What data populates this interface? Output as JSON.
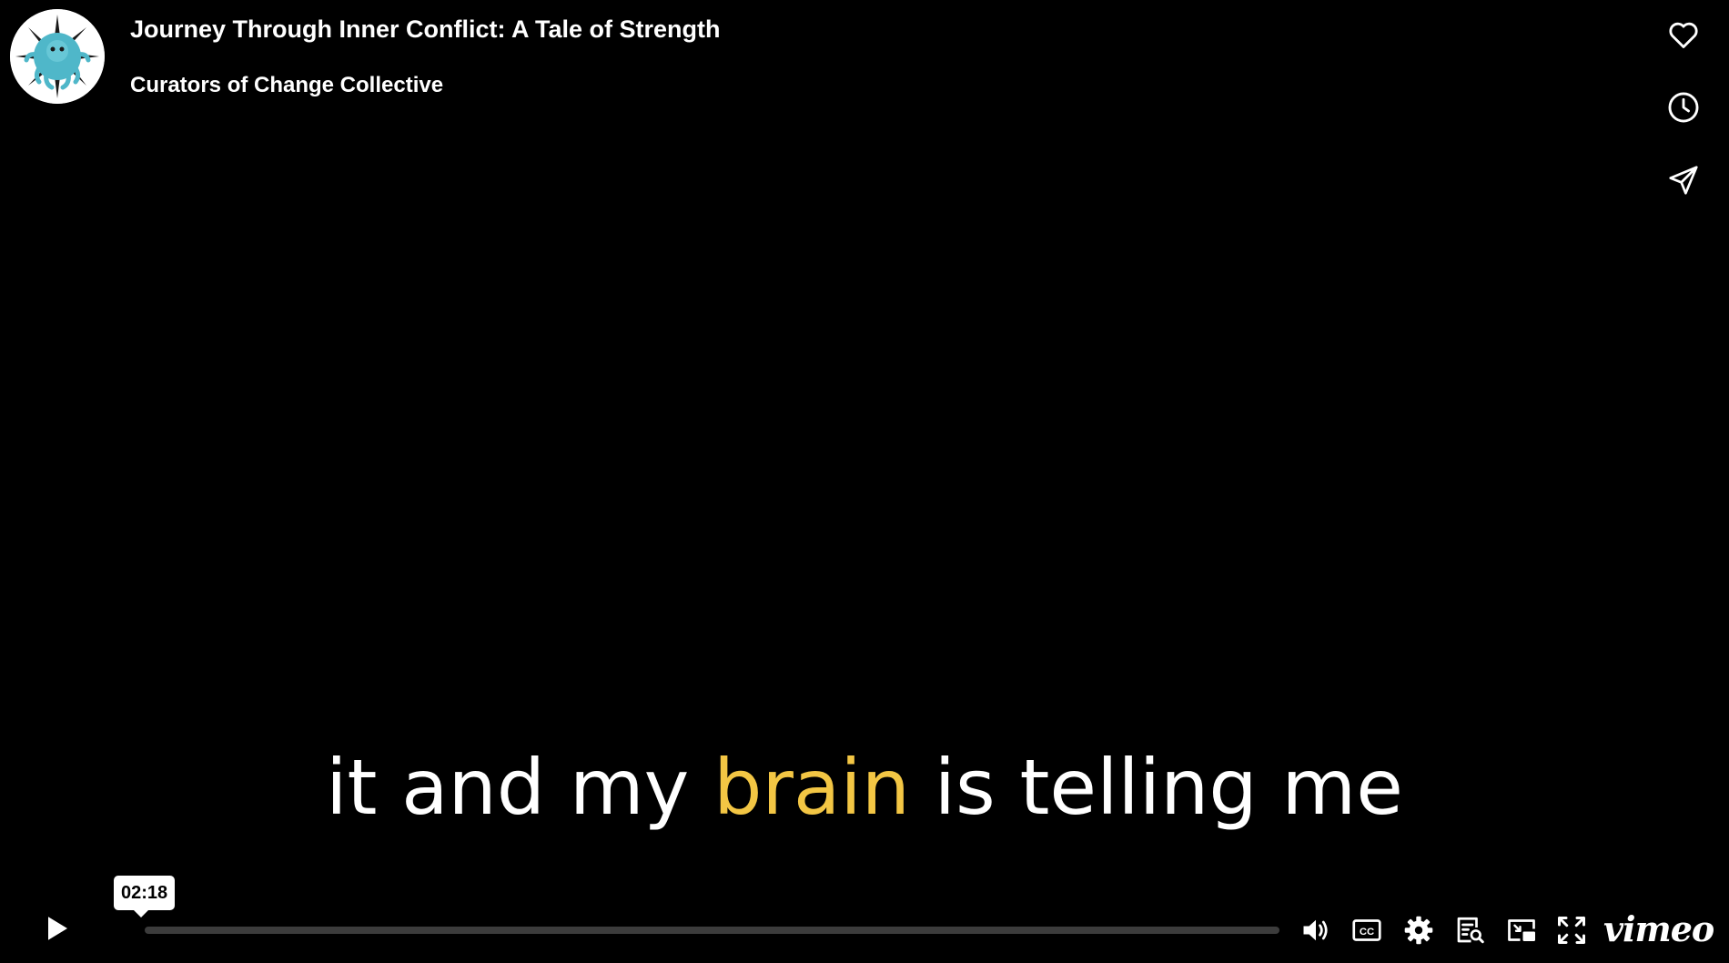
{
  "header": {
    "title": "Journey Through Inner Conflict: A Tale of Strength",
    "byline": "Curators of Change Collective"
  },
  "side_actions": {
    "like": "heart-icon",
    "watch_later": "clock-icon",
    "share": "send-icon"
  },
  "caption": {
    "before": "it and my ",
    "highlight": "brain",
    "after": " is telling me",
    "highlight_color": "#f3c644"
  },
  "controls": {
    "hover_time": "02:18",
    "progress_fraction": 0.0,
    "brand": "vimeo",
    "icons": [
      "play-icon",
      "volume-icon",
      "closed-captions-icon",
      "settings-gear-icon",
      "transcript-icon",
      "picture-in-picture-icon",
      "fullscreen-icon"
    ]
  },
  "colors": {
    "background": "#000000",
    "text": "#ffffff",
    "accent_caption": "#f3c644",
    "progress_track": "#3c3c3c"
  }
}
